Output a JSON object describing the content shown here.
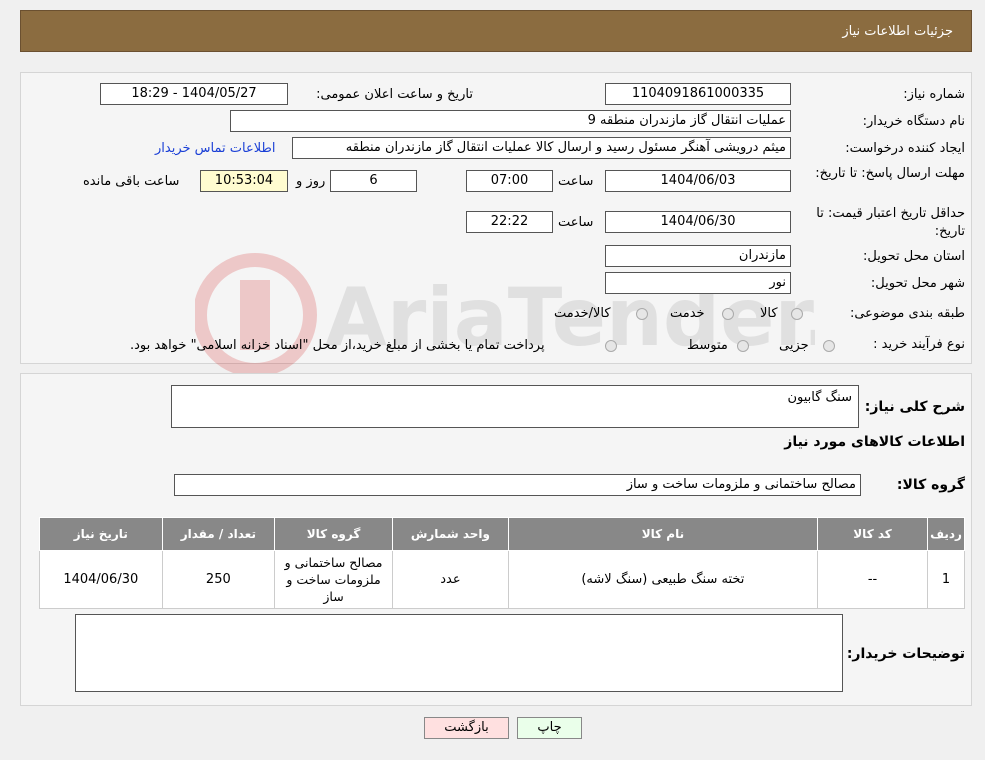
{
  "header": {
    "title": "جزئیات اطلاعات نیاز"
  },
  "form": {
    "need_number_label": "شماره نیاز:",
    "need_number": "1104091861000335",
    "announce_label": "تاریخ و ساعت اعلان عمومی:",
    "announce_value": "1404/05/27 - 18:29",
    "buyer_org_label": "نام دستگاه خریدار:",
    "buyer_org": "عملیات انتقال گاز مازندران منطقه 9",
    "creator_label": "ایجاد کننده درخواست:",
    "creator": "میثم درویشی آهنگر مسئول رسید و ارسال کالا عملیات انتقال گاز مازندران منطقه",
    "contact_link": "اطلاعات تماس خریدار",
    "deadline_label": "مهلت ارسال پاسخ: تا تاریخ:",
    "deadline_date": "1404/06/03",
    "time_label": "ساعت",
    "deadline_time": "07:00",
    "days": "6",
    "days_and": "روز و",
    "remaining": "10:53:04",
    "remaining_label": "ساعت باقی مانده",
    "validity_label": "حداقل تاریخ اعتبار قیمت: تا تاریخ:",
    "validity_date": "1404/06/30",
    "validity_time": "22:22",
    "province_label": "استان محل تحویل:",
    "province": "مازندران",
    "city_label": "شهر محل تحویل:",
    "city": "نور",
    "category_label": "طبقه بندی موضوعی:",
    "category_options": [
      "کالا",
      "خدمت",
      "کالا/خدمت"
    ],
    "process_label": "نوع فرآیند خرید :",
    "process_options": [
      "جزیی",
      "متوسط"
    ],
    "process_note": "پرداخت تمام یا بخشی از مبلغ خرید،از محل \"اسناد خزانه اسلامی\" خواهد بود."
  },
  "summary": {
    "desc_label": "شرح کلی نیاز:",
    "desc_value": "سنگ گابیون",
    "items_heading": "اطلاعات کالاهای مورد نیاز",
    "group_label": "گروه کالا:",
    "group_value": "مصالح ساختمانی و ملزومات ساخت و ساز",
    "table": {
      "headers": [
        "ردیف",
        "کد کالا",
        "نام کالا",
        "واحد شمارش",
        "گروه کالا",
        "تعداد / مقدار",
        "تاریخ نیاز"
      ],
      "rows": [
        [
          "1",
          "--",
          "تخته سنگ طبیعی (سنگ لاشه)",
          "عدد",
          "مصالح ساختمانی و ملزومات ساخت و ساز",
          "250",
          "1404/06/30"
        ]
      ]
    },
    "buyer_notes_label": "توضیحات خریدار:"
  },
  "buttons": {
    "print": "چاپ",
    "back": "بازگشت"
  },
  "watermark": "AriaTender.neT",
  "colors": {
    "header_bg": "#8b6c40",
    "table_header": "#888888",
    "back_btn": "#ffe0e0",
    "print_btn": "#eaffea"
  }
}
